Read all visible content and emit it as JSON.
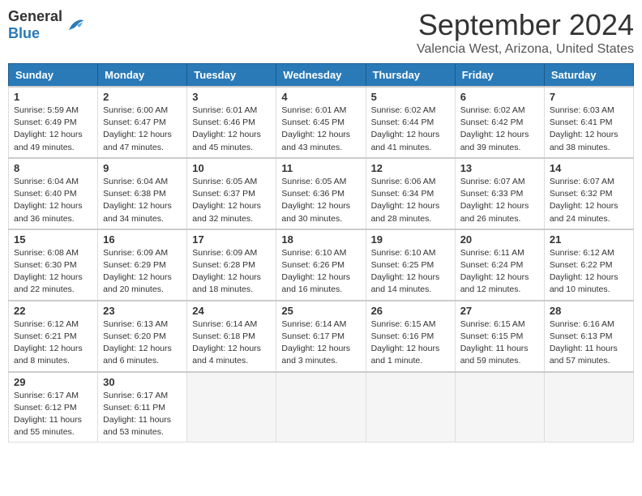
{
  "header": {
    "logo_general": "General",
    "logo_blue": "Blue",
    "title": "September 2024",
    "location": "Valencia West, Arizona, United States"
  },
  "days_of_week": [
    "Sunday",
    "Monday",
    "Tuesday",
    "Wednesday",
    "Thursday",
    "Friday",
    "Saturday"
  ],
  "weeks": [
    [
      {
        "day": "1",
        "sunrise": "Sunrise: 5:59 AM",
        "sunset": "Sunset: 6:49 PM",
        "daylight": "Daylight: 12 hours and 49 minutes."
      },
      {
        "day": "2",
        "sunrise": "Sunrise: 6:00 AM",
        "sunset": "Sunset: 6:47 PM",
        "daylight": "Daylight: 12 hours and 47 minutes."
      },
      {
        "day": "3",
        "sunrise": "Sunrise: 6:01 AM",
        "sunset": "Sunset: 6:46 PM",
        "daylight": "Daylight: 12 hours and 45 minutes."
      },
      {
        "day": "4",
        "sunrise": "Sunrise: 6:01 AM",
        "sunset": "Sunset: 6:45 PM",
        "daylight": "Daylight: 12 hours and 43 minutes."
      },
      {
        "day": "5",
        "sunrise": "Sunrise: 6:02 AM",
        "sunset": "Sunset: 6:44 PM",
        "daylight": "Daylight: 12 hours and 41 minutes."
      },
      {
        "day": "6",
        "sunrise": "Sunrise: 6:02 AM",
        "sunset": "Sunset: 6:42 PM",
        "daylight": "Daylight: 12 hours and 39 minutes."
      },
      {
        "day": "7",
        "sunrise": "Sunrise: 6:03 AM",
        "sunset": "Sunset: 6:41 PM",
        "daylight": "Daylight: 12 hours and 38 minutes."
      }
    ],
    [
      {
        "day": "8",
        "sunrise": "Sunrise: 6:04 AM",
        "sunset": "Sunset: 6:40 PM",
        "daylight": "Daylight: 12 hours and 36 minutes."
      },
      {
        "day": "9",
        "sunrise": "Sunrise: 6:04 AM",
        "sunset": "Sunset: 6:38 PM",
        "daylight": "Daylight: 12 hours and 34 minutes."
      },
      {
        "day": "10",
        "sunrise": "Sunrise: 6:05 AM",
        "sunset": "Sunset: 6:37 PM",
        "daylight": "Daylight: 12 hours and 32 minutes."
      },
      {
        "day": "11",
        "sunrise": "Sunrise: 6:05 AM",
        "sunset": "Sunset: 6:36 PM",
        "daylight": "Daylight: 12 hours and 30 minutes."
      },
      {
        "day": "12",
        "sunrise": "Sunrise: 6:06 AM",
        "sunset": "Sunset: 6:34 PM",
        "daylight": "Daylight: 12 hours and 28 minutes."
      },
      {
        "day": "13",
        "sunrise": "Sunrise: 6:07 AM",
        "sunset": "Sunset: 6:33 PM",
        "daylight": "Daylight: 12 hours and 26 minutes."
      },
      {
        "day": "14",
        "sunrise": "Sunrise: 6:07 AM",
        "sunset": "Sunset: 6:32 PM",
        "daylight": "Daylight: 12 hours and 24 minutes."
      }
    ],
    [
      {
        "day": "15",
        "sunrise": "Sunrise: 6:08 AM",
        "sunset": "Sunset: 6:30 PM",
        "daylight": "Daylight: 12 hours and 22 minutes."
      },
      {
        "day": "16",
        "sunrise": "Sunrise: 6:09 AM",
        "sunset": "Sunset: 6:29 PM",
        "daylight": "Daylight: 12 hours and 20 minutes."
      },
      {
        "day": "17",
        "sunrise": "Sunrise: 6:09 AM",
        "sunset": "Sunset: 6:28 PM",
        "daylight": "Daylight: 12 hours and 18 minutes."
      },
      {
        "day": "18",
        "sunrise": "Sunrise: 6:10 AM",
        "sunset": "Sunset: 6:26 PM",
        "daylight": "Daylight: 12 hours and 16 minutes."
      },
      {
        "day": "19",
        "sunrise": "Sunrise: 6:10 AM",
        "sunset": "Sunset: 6:25 PM",
        "daylight": "Daylight: 12 hours and 14 minutes."
      },
      {
        "day": "20",
        "sunrise": "Sunrise: 6:11 AM",
        "sunset": "Sunset: 6:24 PM",
        "daylight": "Daylight: 12 hours and 12 minutes."
      },
      {
        "day": "21",
        "sunrise": "Sunrise: 6:12 AM",
        "sunset": "Sunset: 6:22 PM",
        "daylight": "Daylight: 12 hours and 10 minutes."
      }
    ],
    [
      {
        "day": "22",
        "sunrise": "Sunrise: 6:12 AM",
        "sunset": "Sunset: 6:21 PM",
        "daylight": "Daylight: 12 hours and 8 minutes."
      },
      {
        "day": "23",
        "sunrise": "Sunrise: 6:13 AM",
        "sunset": "Sunset: 6:20 PM",
        "daylight": "Daylight: 12 hours and 6 minutes."
      },
      {
        "day": "24",
        "sunrise": "Sunrise: 6:14 AM",
        "sunset": "Sunset: 6:18 PM",
        "daylight": "Daylight: 12 hours and 4 minutes."
      },
      {
        "day": "25",
        "sunrise": "Sunrise: 6:14 AM",
        "sunset": "Sunset: 6:17 PM",
        "daylight": "Daylight: 12 hours and 3 minutes."
      },
      {
        "day": "26",
        "sunrise": "Sunrise: 6:15 AM",
        "sunset": "Sunset: 6:16 PM",
        "daylight": "Daylight: 12 hours and 1 minute."
      },
      {
        "day": "27",
        "sunrise": "Sunrise: 6:15 AM",
        "sunset": "Sunset: 6:15 PM",
        "daylight": "Daylight: 11 hours and 59 minutes."
      },
      {
        "day": "28",
        "sunrise": "Sunrise: 6:16 AM",
        "sunset": "Sunset: 6:13 PM",
        "daylight": "Daylight: 11 hours and 57 minutes."
      }
    ],
    [
      {
        "day": "29",
        "sunrise": "Sunrise: 6:17 AM",
        "sunset": "Sunset: 6:12 PM",
        "daylight": "Daylight: 11 hours and 55 minutes."
      },
      {
        "day": "30",
        "sunrise": "Sunrise: 6:17 AM",
        "sunset": "Sunset: 6:11 PM",
        "daylight": "Daylight: 11 hours and 53 minutes."
      },
      null,
      null,
      null,
      null,
      null
    ]
  ]
}
